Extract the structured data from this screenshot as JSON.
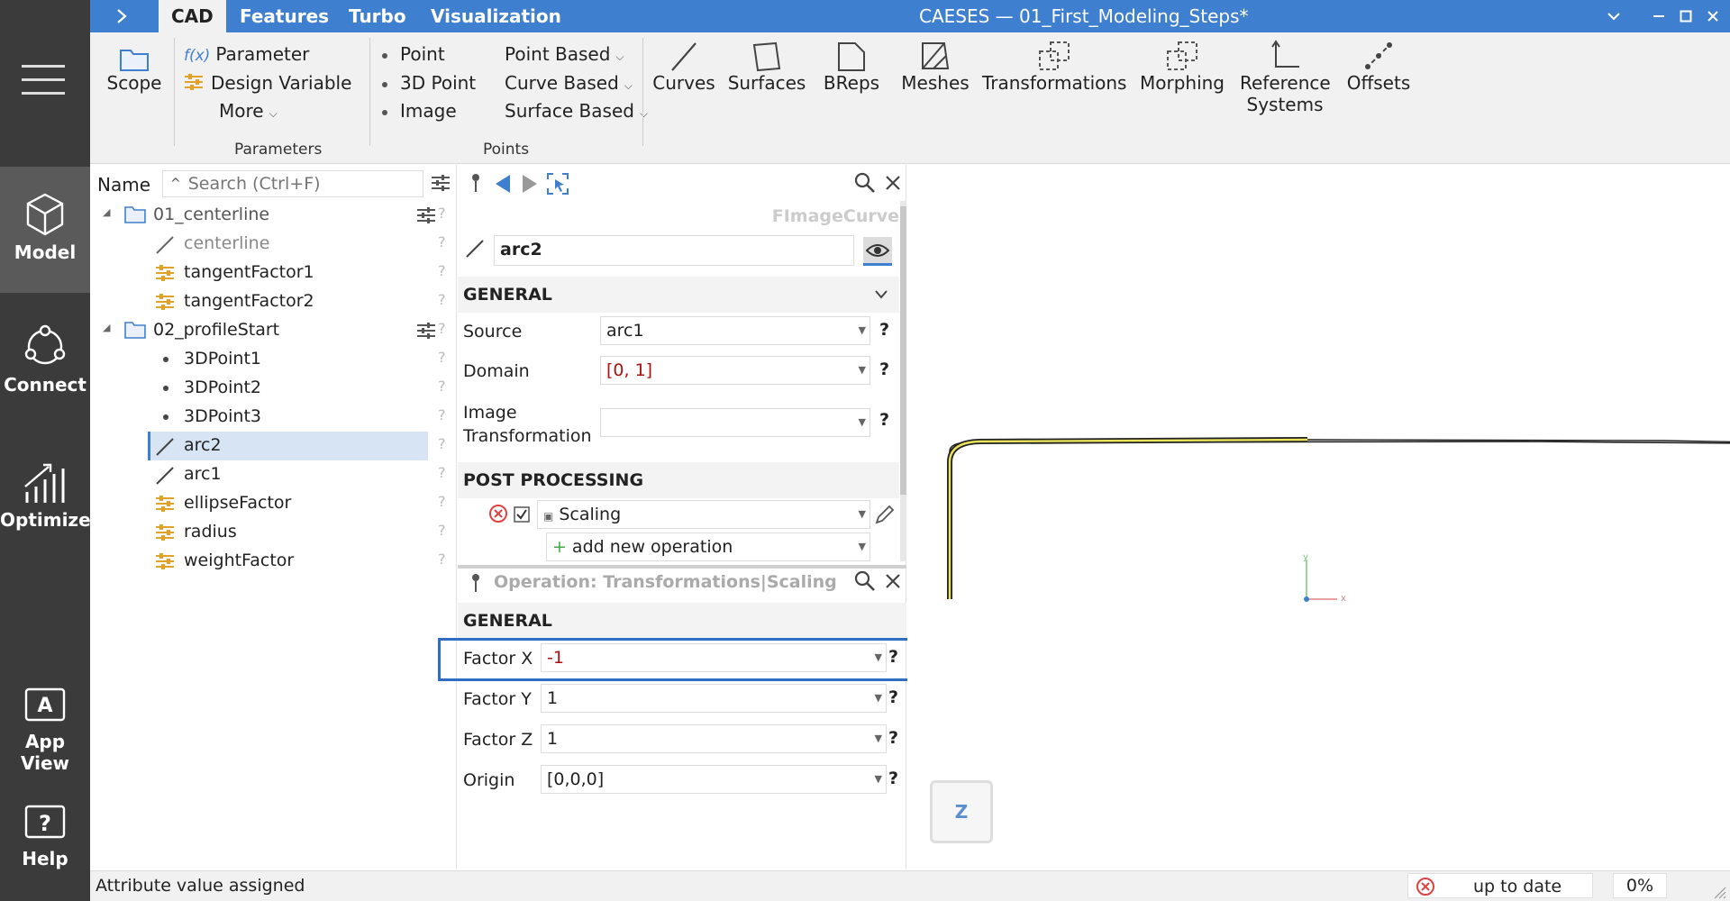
{
  "window": {
    "title": "CAESES — 01_First_Modeling_Steps*",
    "tabs": [
      "CAD",
      "Features",
      "Turbo",
      "Visualization"
    ]
  },
  "nav": {
    "items": [
      {
        "label": "Model"
      },
      {
        "label": "Connect"
      },
      {
        "label": "Optimize"
      },
      {
        "label": "App View"
      },
      {
        "label": "Help"
      }
    ]
  },
  "ribbon": {
    "scope": "Scope",
    "parameter": "Parameter",
    "design_variable": "Design Variable",
    "more": "More",
    "parameters_group": "Parameters",
    "point": "Point",
    "point_3d": "3D Point",
    "image": "Image",
    "point_based": "Point Based",
    "curve_based": "Curve Based",
    "surface_based": "Surface Based",
    "points_group": "Points",
    "curves": "Curves",
    "surfaces": "Surfaces",
    "breps": "BReps",
    "meshes": "Meshes",
    "transformations": "Transformations",
    "morphing": "Morphing",
    "reference_systems_1": "Reference",
    "reference_systems_2": "Systems",
    "offsets": "Offsets",
    "fx": "f(x)"
  },
  "tree": {
    "name_header": "Name",
    "search_placeholder": "Search (Ctrl+F)",
    "q": "?",
    "items": [
      {
        "label": "01_centerline"
      },
      {
        "label": "centerline"
      },
      {
        "label": "tangentFactor1"
      },
      {
        "label": "tangentFactor2"
      },
      {
        "label": "02_profileStart"
      },
      {
        "label": "3DPoint1"
      },
      {
        "label": "3DPoint2"
      },
      {
        "label": "3DPoint3"
      },
      {
        "label": "arc2"
      },
      {
        "label": "arc1"
      },
      {
        "label": "ellipseFactor"
      },
      {
        "label": "radius"
      },
      {
        "label": "weightFactor"
      }
    ]
  },
  "props": {
    "type_label": "FImageCurve",
    "name_value": "arc2",
    "general": "GENERAL",
    "source_label": "Source",
    "source_value": "arc1",
    "domain_label": "Domain",
    "domain_value": "[0, 1]",
    "image_label_1": "Image",
    "image_label_2": "Transformation",
    "image_value": "",
    "post_processing": "POST PROCESSING",
    "scaling": "Scaling",
    "add_op": "add new operation",
    "op_title": "Operation: Transformations|Scaling",
    "general2": "GENERAL",
    "factor_x_label": "Factor  X",
    "factor_x_value": "-1",
    "factor_y_label": "Factor  Y",
    "factor_y_value": "1",
    "factor_z_label": "Factor  Z",
    "factor_z_value": "1",
    "origin_label": "Origin",
    "origin_value": "[0,0,0]",
    "q": "?"
  },
  "viewport": {
    "axis_y": "y",
    "axis_x": "x",
    "view_cube": "Z"
  },
  "status": {
    "message": "Attribute value assigned",
    "state": "up to date",
    "progress": "0%"
  },
  "colors": {
    "accent": "#3f7fcf",
    "highlight_box": "#2f6ec4",
    "folder": "#3f7fcf",
    "param_icon": "#e2a227",
    "error": "#e04040"
  }
}
